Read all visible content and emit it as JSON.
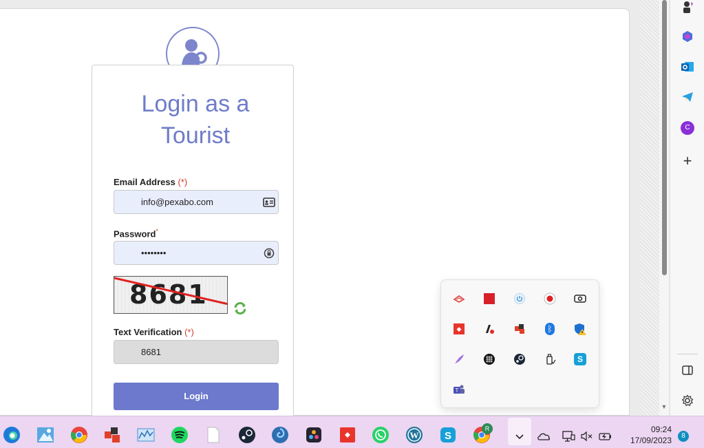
{
  "login": {
    "title_line1": "Login as a",
    "title_line2": "Tourist",
    "email_label": "Email Address",
    "email_required": "(*)",
    "email_value": "info@pexabo.com",
    "password_label": "Password",
    "password_required": "*",
    "password_value": "••••••••",
    "captcha_text": "8681",
    "verification_label": "Text Verification",
    "verification_required": "(*)",
    "verification_value": "8681",
    "login_button": "Login"
  },
  "sidebar": {
    "icons": [
      "chess-icon",
      "copilot-icon",
      "outlook-icon",
      "telegram-icon",
      "c-avatar-icon",
      "add-icon",
      "sidebar-toggle-icon",
      "settings-icon"
    ],
    "avatar_letter": "C"
  },
  "tray": {
    "icons": [
      "cloud-sync-icon",
      "amd-icon",
      "power-icon",
      "record-icon",
      "camera-icon",
      "anydesk-icon",
      "audio-icon",
      "paint-icon",
      "bluetooth-icon",
      "security-warning-icon",
      "quill-icon",
      "grid-icon",
      "steam-icon",
      "usb-icon",
      "skype-icon",
      "teams-icon"
    ]
  },
  "taskbar": {
    "apps": [
      "edge",
      "photo",
      "chrome",
      "paint",
      "monitor",
      "spotify",
      "file",
      "steam",
      "swirl",
      "davinci",
      "anydesk",
      "whatsapp",
      "wordpress",
      "skype",
      "chrome-profile"
    ],
    "chrome_profile_letter": "R",
    "time": "09:24",
    "date": "17/09/2023",
    "notification_count": "8"
  },
  "colors": {
    "accent": "#6c79cc",
    "title": "#6f7cc9",
    "required": "#d13a2b",
    "taskbar": "#ecd6f2"
  }
}
